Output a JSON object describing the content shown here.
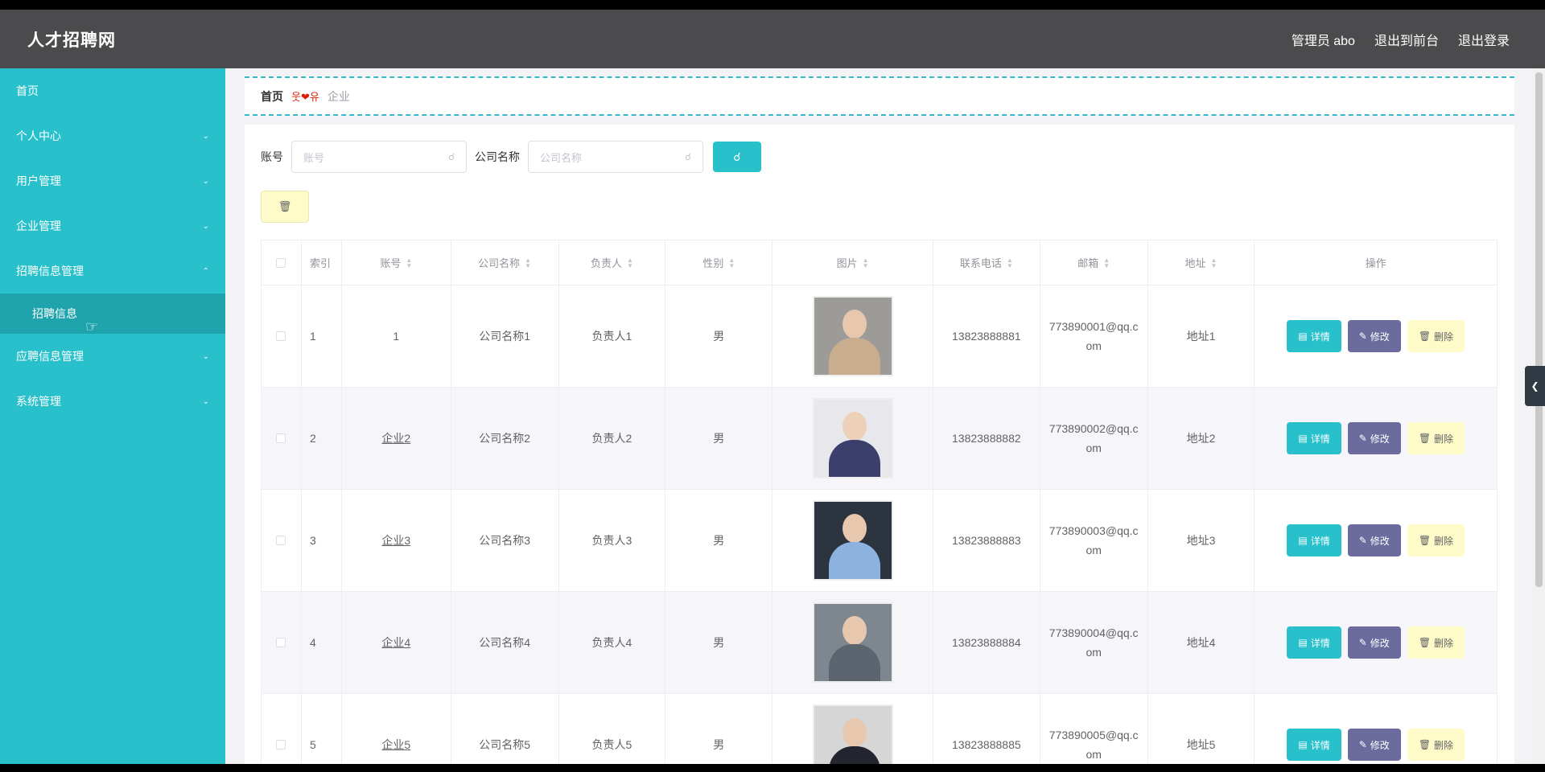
{
  "header": {
    "brand": "人才招聘网",
    "nav": [
      "管理员 abo",
      "退出到前台",
      "退出登录"
    ]
  },
  "sidebar": {
    "items": [
      {
        "label": "首页",
        "has_arrow": false
      },
      {
        "label": "个人中心",
        "has_arrow": true
      },
      {
        "label": "用户管理",
        "has_arrow": true
      },
      {
        "label": "企业管理",
        "has_arrow": true
      },
      {
        "label": "招聘信息管理",
        "has_arrow": true,
        "expanded": true
      },
      {
        "label": "应聘信息管理",
        "has_arrow": true
      },
      {
        "label": "系统管理",
        "has_arrow": true
      }
    ],
    "sub_item": "招聘信息"
  },
  "breadcrumb": {
    "home": "首页",
    "separator": "웃❤유",
    "current": "企业"
  },
  "search": {
    "account_label": "账号",
    "account_placeholder": "账号",
    "company_label": "公司名称",
    "company_placeholder": "公司名称"
  },
  "table": {
    "columns": [
      "索引",
      "账号",
      "公司名称",
      "负责人",
      "性别",
      "图片",
      "联系电话",
      "邮箱",
      "地址",
      "操作"
    ],
    "rows": [
      {
        "index": "1",
        "account": "1",
        "company": "公司名称1",
        "manager": "负责人1",
        "gender": "男",
        "phone": "13823888881",
        "email": "773890001@qq.com",
        "address": "地址1"
      },
      {
        "index": "2",
        "account": "企业2",
        "company": "公司名称2",
        "manager": "负责人2",
        "gender": "男",
        "phone": "13823888882",
        "email": "773890002@qq.com",
        "address": "地址2"
      },
      {
        "index": "3",
        "account": "企业3",
        "company": "公司名称3",
        "manager": "负责人3",
        "gender": "男",
        "phone": "13823888883",
        "email": "773890003@qq.com",
        "address": "地址3"
      },
      {
        "index": "4",
        "account": "企业4",
        "company": "公司名称4",
        "manager": "负责人4",
        "gender": "男",
        "phone": "13823888884",
        "email": "773890004@qq.com",
        "address": "地址4"
      },
      {
        "index": "5",
        "account": "企业5",
        "company": "公司名称5",
        "manager": "负责人5",
        "gender": "男",
        "phone": "13823888885",
        "email": "773890005@qq.com",
        "address": "地址5"
      }
    ],
    "actions": {
      "detail": "详情",
      "edit": "修改",
      "delete": "删除"
    }
  },
  "colors": {
    "accent": "#27c0cb",
    "topbar": "#4b4b4d",
    "edit_button": "#6b6b9e",
    "delete_button": "#fffbc9",
    "photo_suits": [
      "#c9ad8f",
      "#3a3f6b",
      "#8cb3e0",
      "#5c6470",
      "#23262e"
    ]
  }
}
